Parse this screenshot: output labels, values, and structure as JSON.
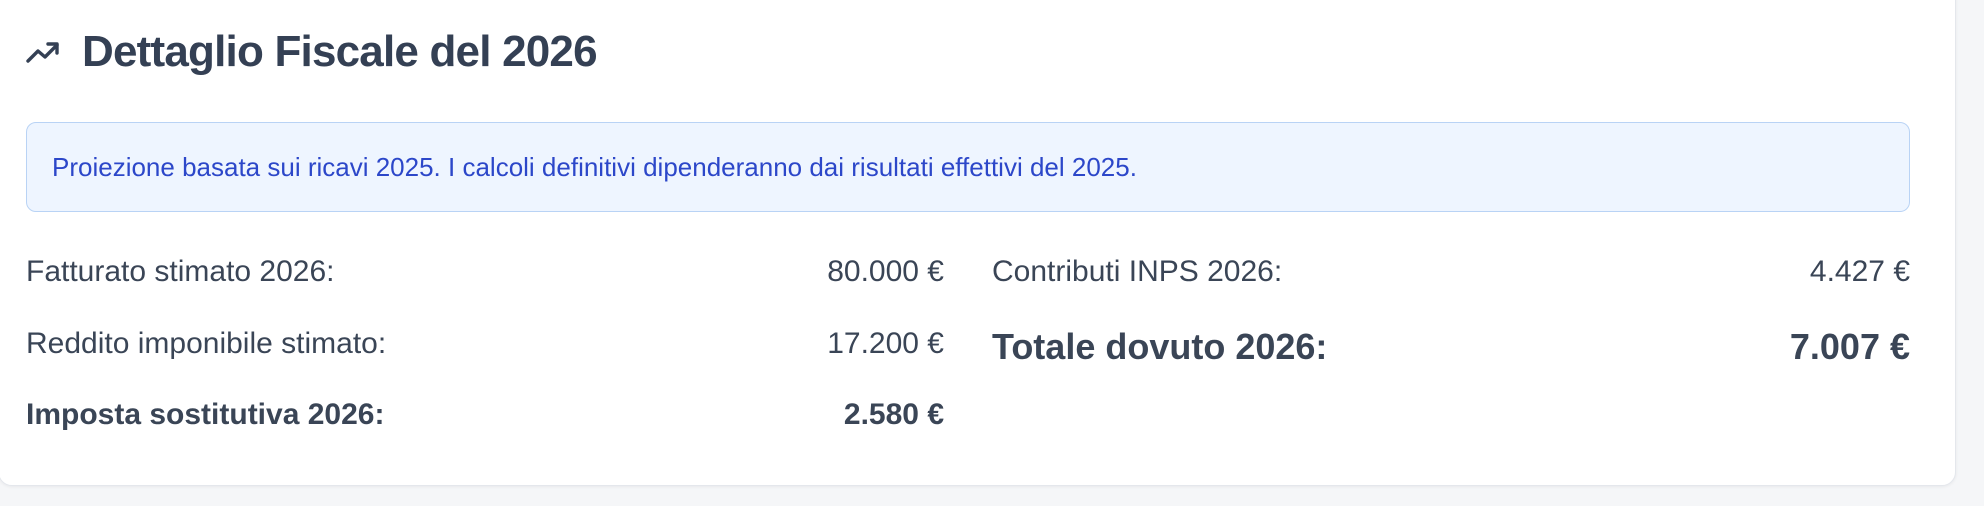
{
  "header": {
    "icon": "trending-up-icon",
    "title": "Dettaglio Fiscale del 2026"
  },
  "notice": {
    "text": "Proiezione basata sui ricavi 2025. I calcoli definitivi dipenderanno dai risultati effettivi del 2025."
  },
  "left_items": [
    {
      "label": "Fatturato stimato 2026:",
      "value": "80.000 €"
    },
    {
      "label": "Reddito imponibile stimato:",
      "value": "17.200 €"
    },
    {
      "label": "Imposta sostitutiva 2026:",
      "value": "2.580 €"
    }
  ],
  "right_items": [
    {
      "label": "Contributi INPS 2026:",
      "value": "4.427 €"
    },
    {
      "label": "Totale dovuto 2026:",
      "value": "7.007 €"
    }
  ],
  "colors": {
    "title": "#344054",
    "notice_bg": "#eef5ff",
    "notice_border": "#b9d3f5",
    "notice_text": "#2c47c9"
  }
}
